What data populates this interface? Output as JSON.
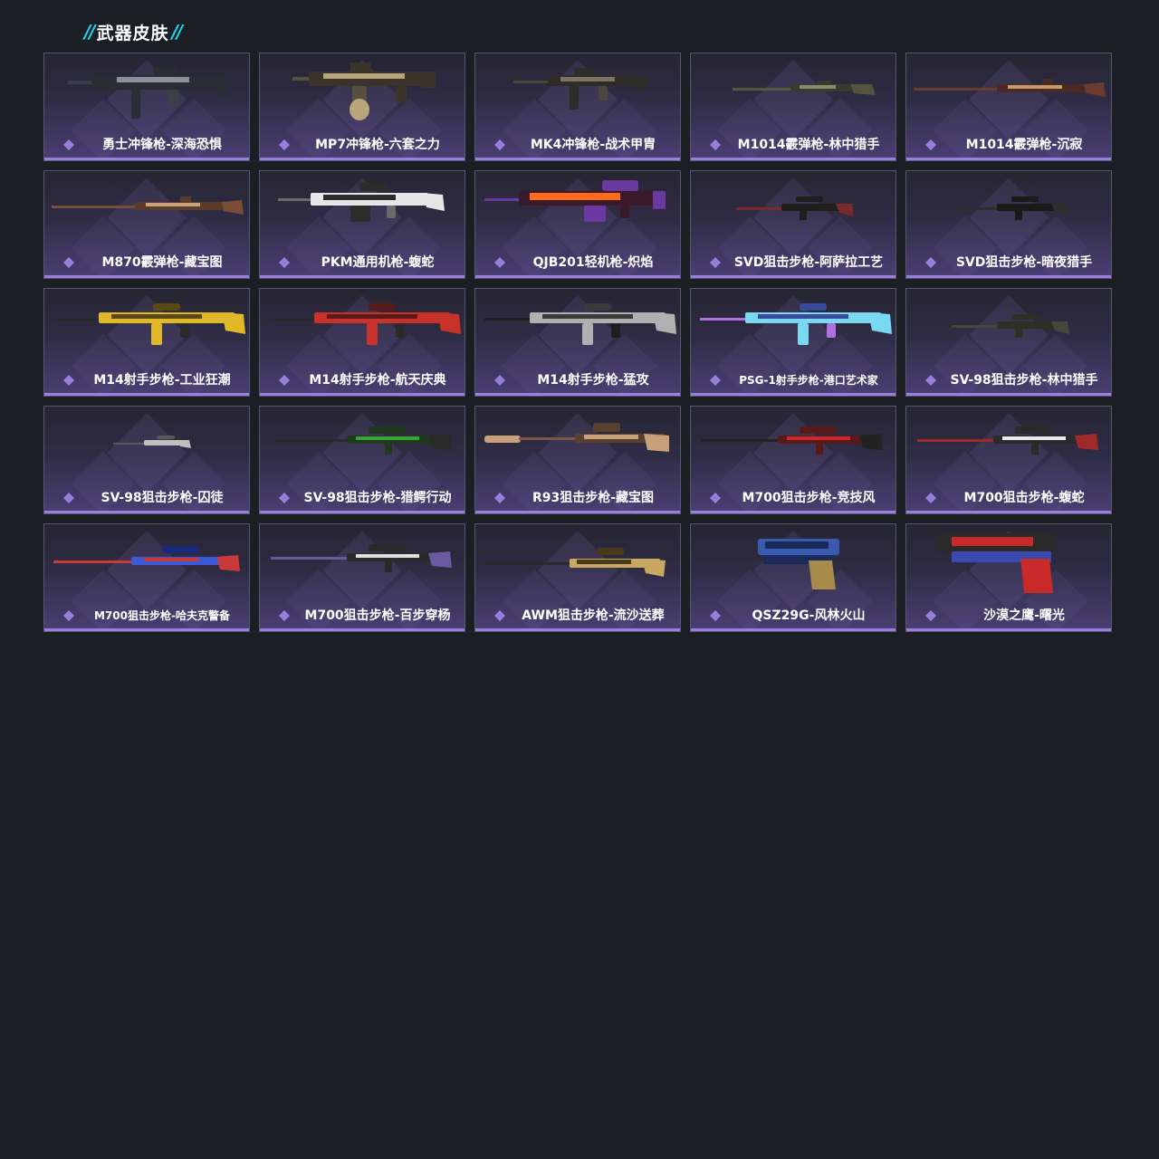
{
  "section": {
    "title": "武器皮肤",
    "title_icon": "double-slash-icon"
  },
  "colors": {
    "background": "#1b1f23",
    "accent_cyan": "#1fd2f0",
    "card_border": "#5a5870",
    "rarity_purple": "#9a7fe0"
  },
  "skins": [
    {
      "label": "勇士冲锋枪-深海恐惧",
      "weapon_type": "smg",
      "palette": [
        "#2a2d33",
        "#8a8f99",
        "#3b3f48"
      ]
    },
    {
      "label": "MP7冲锋枪-六套之力",
      "weapon_type": "smg-drum",
      "palette": [
        "#3a342a",
        "#b8a57a",
        "#57503f"
      ]
    },
    {
      "label": "MK4冲锋枪-战术甲胄",
      "weapon_type": "rifle-short",
      "palette": [
        "#2e2c28",
        "#7b7465",
        "#4a463d"
      ]
    },
    {
      "label": "M1014霰弹枪-林中猎手",
      "weapon_type": "shotgun",
      "palette": [
        "#3a3a30",
        "#8b8a6a",
        "#55553f"
      ]
    },
    {
      "label": "M1014霰弹枪-沉寂",
      "weapon_type": "shotgun-long",
      "palette": [
        "#4a2a24",
        "#c79a6a",
        "#6b3b2f"
      ]
    },
    {
      "label": "M870霰弹枪-藏宝图",
      "weapon_type": "shotgun-long",
      "palette": [
        "#5a3a2a",
        "#c9a27a",
        "#7a4e36"
      ]
    },
    {
      "label": "PKM通用机枪-蝮蛇",
      "weapon_type": "lmg",
      "palette": [
        "#2c2c2c",
        "#e6e6e6",
        "#6a6a6a"
      ]
    },
    {
      "label": "QJB201轻机枪-炽焰",
      "weapon_type": "lmg-fire",
      "palette": [
        "#3a1a2a",
        "#ff6a1a",
        "#6a3aa0"
      ]
    },
    {
      "label": "SVD狙击步枪-阿萨拉工艺",
      "weapon_type": "sniper-small",
      "palette": [
        "#1e1e1e",
        "#6a6a6a",
        "#7a2a2a"
      ]
    },
    {
      "label": "SVD狙击步枪-暗夜猎手",
      "weapon_type": "sniper-small",
      "palette": [
        "#1a1a1a",
        "#5a5a5a",
        "#2e2e2e"
      ]
    },
    {
      "label": "M14射手步枪-工业狂潮",
      "weapon_type": "dmr",
      "palette": [
        "#5a4a12",
        "#e0b828",
        "#2a2a2a"
      ]
    },
    {
      "label": "M14射手步枪-航天庆典",
      "weapon_type": "dmr",
      "palette": [
        "#5a1a1a",
        "#c8322a",
        "#2a2a2a"
      ]
    },
    {
      "label": "M14射手步枪-猛攻",
      "weapon_type": "dmr-gray",
      "palette": [
        "#3a3a3a",
        "#b0b0b0",
        "#1e1e1e"
      ]
    },
    {
      "label": "PSG-1射手步枪-港口艺术家",
      "weapon_type": "dmr-art",
      "palette": [
        "#3a4a9a",
        "#7ad8f0",
        "#b070e0"
      ],
      "small": true
    },
    {
      "label": "SV-98狙击步枪-林中猎手",
      "weapon_type": "sniper-small",
      "palette": [
        "#2e3024",
        "#7a7a58",
        "#45473a"
      ]
    },
    {
      "label": "SV-98狙击步枪-囚徒",
      "weapon_type": "sniper-tiny",
      "palette": [
        "#2a2a2a",
        "#c0c0c0",
        "#5a5a5a"
      ]
    },
    {
      "label": "SV-98狙击步枪-猎鳄行动",
      "weapon_type": "sniper",
      "palette": [
        "#1e3a1e",
        "#3aa03a",
        "#2a2a2a"
      ]
    },
    {
      "label": "R93狙击步枪-藏宝图",
      "weapon_type": "sniper-tan",
      "palette": [
        "#5a4030",
        "#c8a07a",
        "#7a5a44"
      ]
    },
    {
      "label": "M700狙击步枪-竞技风",
      "weapon_type": "sniper",
      "palette": [
        "#5a1a1a",
        "#c82a2a",
        "#222222"
      ]
    },
    {
      "label": "M700狙击步枪-蝮蛇",
      "weapon_type": "sniper",
      "palette": [
        "#2a2a2a",
        "#e8e8e8",
        "#a02a2a"
      ]
    },
    {
      "label": "M700狙击步枪-哈夫克警备",
      "weapon_type": "sniper-blue",
      "palette": [
        "#1a2a7a",
        "#3a5ad8",
        "#c83a3a"
      ],
      "small": true
    },
    {
      "label": "M700狙击步枪-百步穿杨",
      "weapon_type": "sniper",
      "palette": [
        "#2a2a2a",
        "#e0e0e0",
        "#6a5aa0"
      ]
    },
    {
      "label": "AWM狙击步枪-流沙送葬",
      "weapon_type": "sniper-awm",
      "palette": [
        "#4a3a1a",
        "#c8a860",
        "#2a2a2a"
      ]
    },
    {
      "label": "QSZ29G-风林火山",
      "weapon_type": "pistol",
      "palette": [
        "#1a2a5a",
        "#3a5ab0",
        "#a88a4a"
      ]
    },
    {
      "label": "沙漠之鹰-曙光",
      "weapon_type": "pistol-eagle",
      "palette": [
        "#2a2a2a",
        "#c82a2a",
        "#3a4ab0"
      ]
    }
  ]
}
